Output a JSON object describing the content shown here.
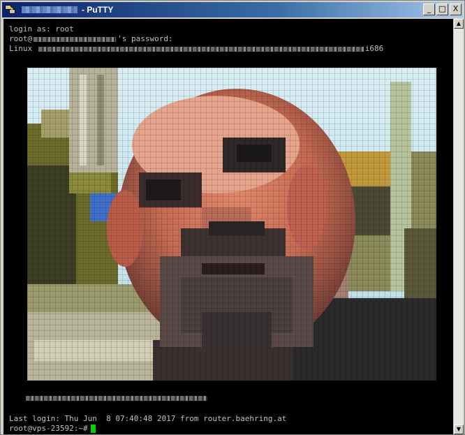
{
  "window": {
    "title": "- PuTTY",
    "controls": {
      "minimize": "_",
      "maximize": "□",
      "close": "X"
    }
  },
  "terminal": {
    "line1": "login as: root",
    "line2_prefix": "root@",
    "line2_suffix": "'s password:",
    "line3_prefix": "Linux ",
    "line3_suffix": "i686",
    "last_login": "Last login: Thu Jun  8 07:40:48 2017 from router.baehring.at",
    "prompt": "root@vps-23592:~#"
  },
  "colors": {
    "terminal_bg": "#000000",
    "terminal_fg": "#c0c0c0",
    "cursor": "#00d000",
    "titlebar_start": "#0a246a",
    "titlebar_end": "#a6caf0"
  },
  "icons": {
    "app": "putty-icon",
    "minimize": "minimize-icon",
    "maximize": "maximize-icon",
    "close": "close-icon"
  }
}
